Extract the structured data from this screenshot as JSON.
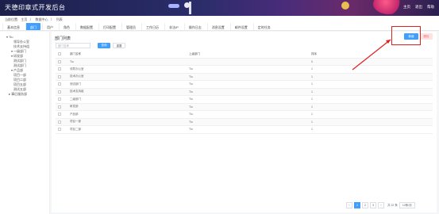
{
  "header": {
    "title": "天德印章式开发后台",
    "user_links": [
      "主页",
      "退出",
      "帮助"
    ]
  },
  "breadcrumb": [
    "当前位置:",
    "主页",
    "〉",
    "数据中心",
    "〉",
    "列表"
  ],
  "tabs": [
    {
      "label": "基本信息"
    },
    {
      "label": "部门",
      "active": true
    },
    {
      "label": "用户"
    },
    {
      "label": "角色"
    },
    {
      "label": "数据配置"
    },
    {
      "label": "打印配置"
    },
    {
      "label": "管理员"
    },
    {
      "label": "工作日历"
    },
    {
      "label": "非法IP"
    },
    {
      "label": "操作日志"
    },
    {
      "label": "消息设置"
    },
    {
      "label": "邮件设置"
    },
    {
      "label": "定时任务"
    }
  ],
  "sidebar": {
    "items": [
      {
        "label": "▾ Tiu"
      },
      {
        "label": "领导办公室"
      },
      {
        "label": "技术支持组"
      },
      {
        "label": "▾ 一级部门"
      },
      {
        "label": "▾ 研发部"
      },
      {
        "label": "测试部门"
      },
      {
        "label": "测试部门"
      },
      {
        "label": "▾ 产品部"
      },
      {
        "label": "项目一部"
      },
      {
        "label": "项目二部"
      },
      {
        "label": "项目五部"
      },
      {
        "label": "测试五部"
      },
      {
        "label": "▸ 事后服务部"
      }
    ]
  },
  "main": {
    "heading": "部门列表",
    "filter_placeholder": "部门名称",
    "search_label": "查询",
    "reset_label": "重置",
    "add_label": "新增",
    "delete_label": "删除",
    "columns": [
      "部门名称",
      "上级部门",
      "排序"
    ],
    "rows": [
      {
        "name": "Tiu",
        "parent": "",
        "sort": "0"
      },
      {
        "name": "领导办公室",
        "parent": "Tiu",
        "sort": "1"
      },
      {
        "name": "技术办公室",
        "parent": "Tiu",
        "sort": "1"
      },
      {
        "name": "测试部门",
        "parent": "Tiu",
        "sort": "1"
      },
      {
        "name": "技术支持组",
        "parent": "Tiu",
        "sort": "1"
      },
      {
        "name": "二级部门",
        "parent": "Tiu",
        "sort": "1"
      },
      {
        "name": "研发部",
        "parent": "Tiu",
        "sort": "1"
      },
      {
        "name": "产品部",
        "parent": "Tiu",
        "sort": "1"
      },
      {
        "name": "项目一部",
        "parent": "Tiu",
        "sort": "1"
      },
      {
        "name": "项目二部",
        "parent": "Tiu",
        "sort": "1"
      }
    ]
  },
  "pager": {
    "prev": "‹",
    "pages": [
      "1",
      "2",
      "3"
    ],
    "next": "›",
    "goto_text": "共 22 条",
    "page_size": "10条/页"
  },
  "colors": {
    "accent": "#409eff",
    "highlight_box": "#e02020",
    "header_bg": "#1b1f4a"
  }
}
